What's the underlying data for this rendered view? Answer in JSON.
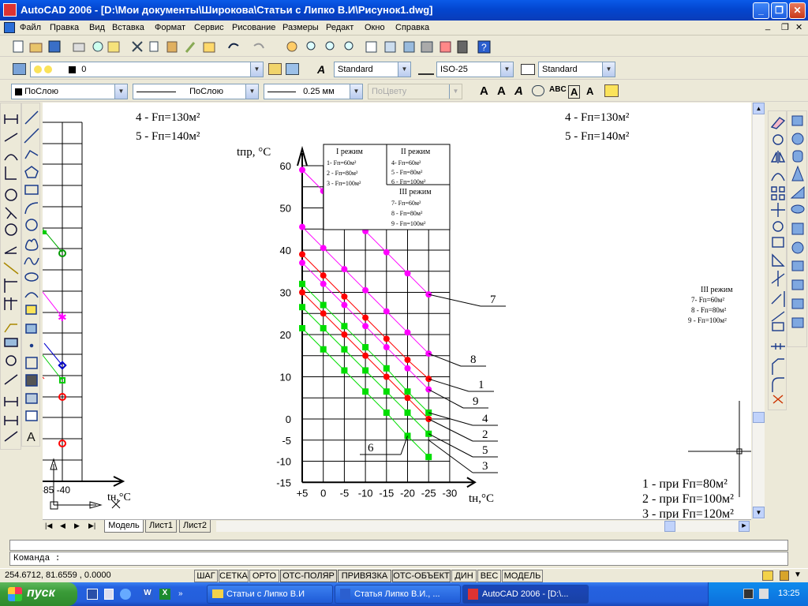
{
  "window": {
    "title": "AutoCAD 2006 - [D:\\Мои документы\\Широкова\\Статьи с Липко В.И\\Рисунок1.dwg]"
  },
  "menu": [
    "Файл",
    "Правка",
    "Вид",
    "Вставка",
    "Формат",
    "Сервис",
    "Рисование",
    "Размеры",
    "Редакт",
    "Окно",
    "Справка"
  ],
  "layers": {
    "current_layer": "0"
  },
  "styles": {
    "text_style": "Standard",
    "dim_style": "ISO-25",
    "table_style": "Standard"
  },
  "properties": {
    "color": "ПоСлою",
    "linetype": "ПоСлою",
    "lineweight": "0.25 мм",
    "plotstyle": "ПоЦвету"
  },
  "drawing_text": {
    "top_left_4": "4 -  Fп=130м²",
    "top_left_5": "5 -  Fп=140м²",
    "top_right_4": "4 -  Fп=130м²",
    "top_right_5": "5 -  Fп=140м²",
    "left_xlabel": "tн,°С",
    "left_tick": "-85  -40",
    "right_legend_title": "III режим",
    "right_legend_7": "7- Fп=60м²",
    "right_legend_8": "8 - Fп=80м²",
    "right_legend_9": "9 - Fп=100м²",
    "bottom_1": "1 - при Fп=80м²",
    "bottom_2": "2 - при Fп=100м²",
    "bottom_3": "3 - при Fп=120м²"
  },
  "chart_data": {
    "type": "line",
    "ylabel": "tпр, °С",
    "xlabel": "tн,°С",
    "x_ticks": [
      "+5",
      "0",
      "-5",
      "-10",
      "-15",
      "-20",
      "-25",
      "-30"
    ],
    "y_ticks": [
      "60",
      "50",
      "40",
      "30",
      "20",
      "10",
      "0",
      "-5",
      "-10",
      "-15"
    ],
    "legend": {
      "col1_title": "I режим",
      "col1": [
        "1- Fп=60м²",
        "2 - Fп=80м²",
        "3 - Fп=100м²"
      ],
      "col2_title": "II режим",
      "col2": [
        "4- Fп=60м²",
        "5 - Fп=80м²",
        "6 - Fп=100м²"
      ],
      "col3_title": "III режим",
      "col3": [
        "7- Fп=60м²",
        "8 - Fп=80м²",
        "9 - Fп=100м²"
      ]
    },
    "series": [
      {
        "name": "7",
        "color": "#ff00ff",
        "x": [
          5,
          0,
          -5,
          -10,
          -15,
          -20,
          -25
        ],
        "y": [
          59,
          54,
          49.5,
          44.5,
          39.5,
          34.5,
          29.5
        ]
      },
      {
        "name": "8",
        "color": "#ff00ff",
        "x": [
          5,
          0,
          -5,
          -10,
          -15,
          -20,
          -25
        ],
        "y": [
          45.5,
          40.5,
          35.5,
          30.5,
          25.5,
          20.5,
          15.5
        ]
      },
      {
        "name": "9",
        "color": "#ff00ff",
        "x": [
          5,
          0,
          -5,
          -10,
          -15,
          -20,
          -25
        ],
        "y": [
          37,
          32,
          27,
          22,
          17,
          12,
          7
        ]
      },
      {
        "name": "1",
        "color": "#ff0000",
        "x": [
          5,
          0,
          -5,
          -10,
          -15,
          -20,
          -25
        ],
        "y": [
          39,
          34,
          29,
          24,
          19,
          14,
          9.5
        ]
      },
      {
        "name": "2",
        "color": "#ff0000",
        "x": [
          5,
          0,
          -5,
          -10,
          -15,
          -20,
          -25
        ],
        "y": [
          30,
          25,
          20,
          15,
          10,
          5,
          0
        ]
      },
      {
        "name": "4",
        "color": "#00dd00",
        "x": [
          5,
          0,
          -5,
          -10,
          -15,
          -20,
          -25
        ],
        "y": [
          32,
          27,
          22,
          17,
          12,
          6.5,
          1.5
        ]
      },
      {
        "name": "5",
        "color": "#00dd00",
        "x": [
          5,
          0,
          -5,
          -10,
          -15,
          -20,
          -25
        ],
        "y": [
          26.5,
          21.5,
          16.5,
          11.5,
          6.5,
          1.5,
          -3.5
        ]
      },
      {
        "name": "6",
        "color": "#00dd00",
        "x": [
          5,
          0,
          -5,
          -10,
          -15,
          -20,
          -25
        ],
        "y": [
          21.5,
          16.5,
          11.5,
          6.5,
          1.5,
          -4,
          -9
        ]
      }
    ],
    "line_labels": [
      "7",
      "8",
      "1",
      "9",
      "4",
      "2",
      "5",
      "3",
      "6"
    ]
  },
  "tabs": [
    "Модель",
    "Лист1",
    "Лист2"
  ],
  "command": {
    "prompt": "Команда :"
  },
  "status": {
    "coords": "254.6712, 81.6559 , 0.0000",
    "buttons": [
      "ШАГ",
      "СЕТКА",
      "ОРТО",
      "ОТС-ПОЛЯР",
      "ПРИВЯЗКА",
      "ОТС-ОБЪЕКТ",
      "ДИН",
      "ВЕС",
      "МОДЕЛЬ"
    ]
  },
  "taskbar": {
    "start": "пуск",
    "tasks": [
      "Статьи с Липко В.И",
      "Статья Липко В.И., ...",
      "AutoCAD 2006 - [D:\\..."
    ],
    "lang": "RU",
    "clock": "13:25"
  }
}
